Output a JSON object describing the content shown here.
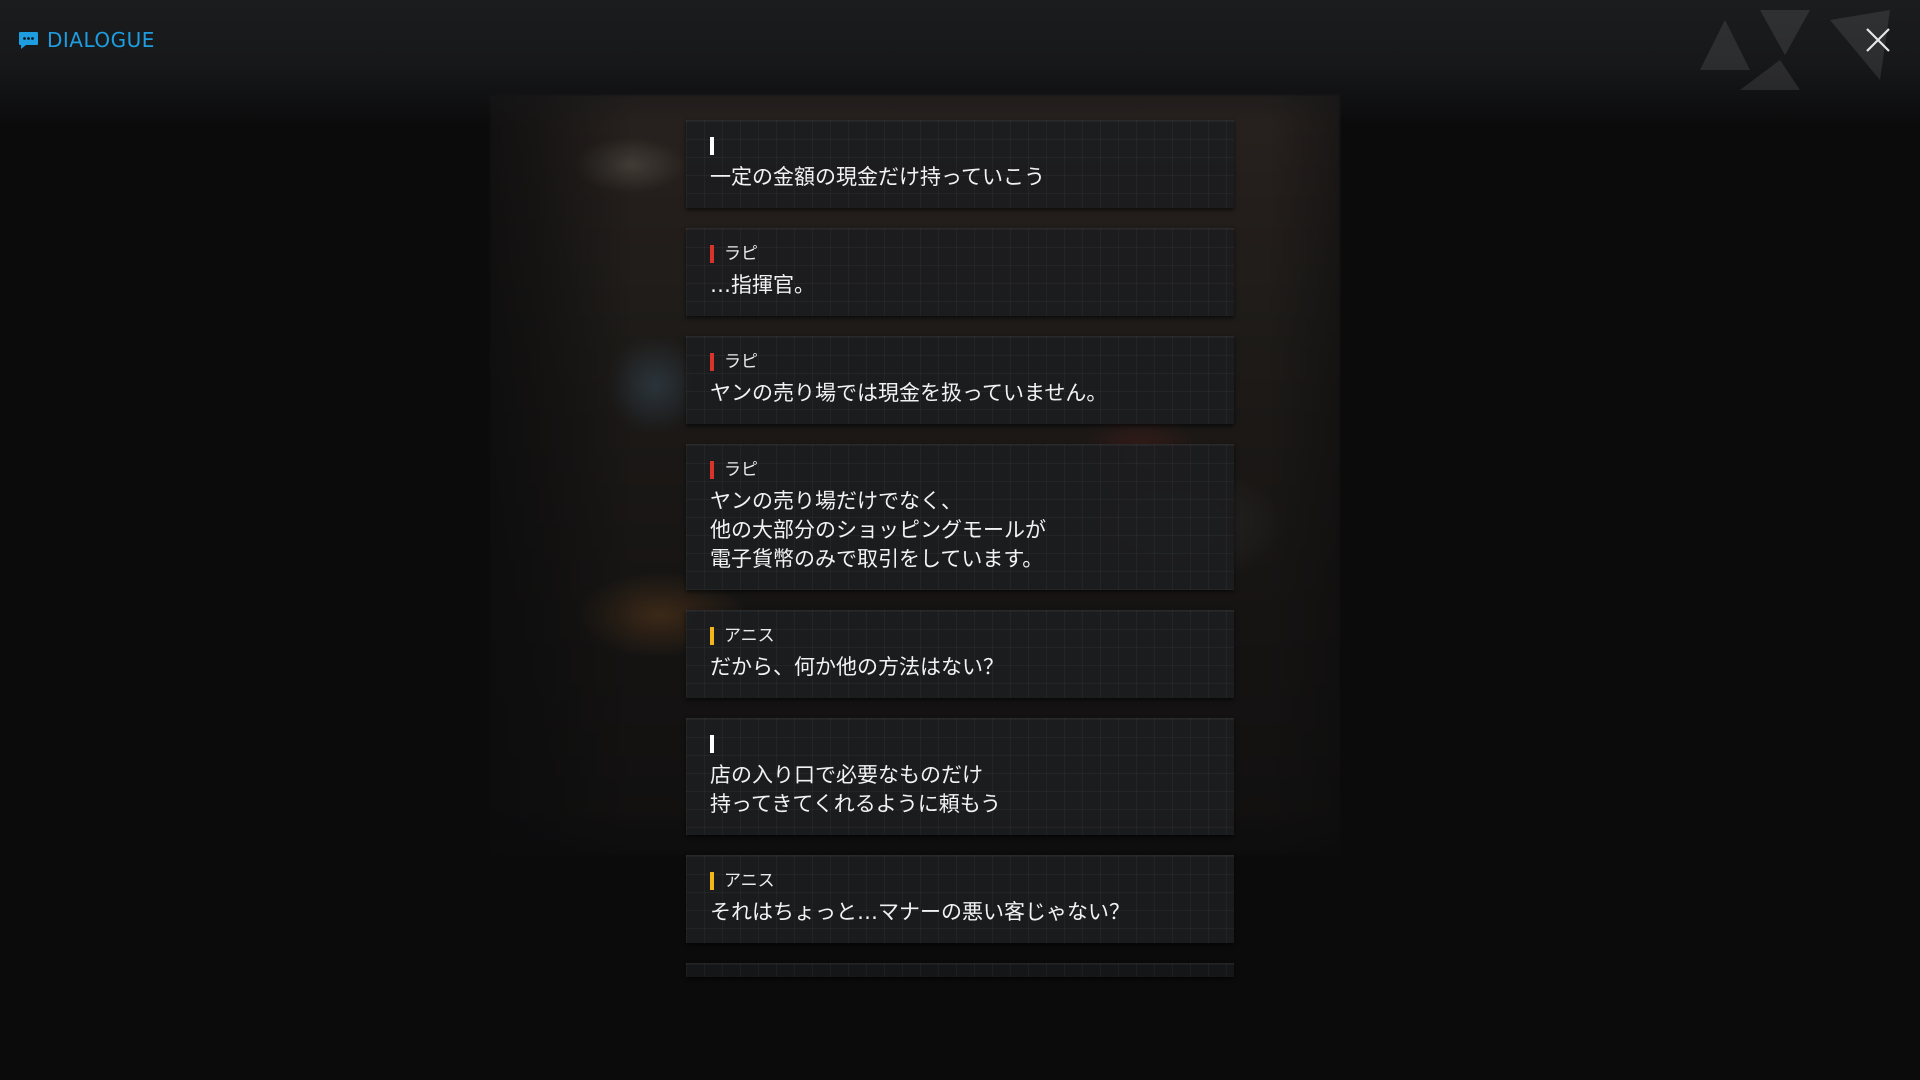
{
  "header": {
    "title": "DIALOGUE",
    "title_icon": "chat-bubble-icon",
    "close_icon": "close-icon",
    "accent_color": "#1e9de0"
  },
  "dialogue": [
    {
      "speaker": "",
      "speaker_color": "#ffffff",
      "text": "一定の金額の現金だけ持っていこう"
    },
    {
      "speaker": "ラピ",
      "speaker_color": "#d9342b",
      "text": "…指揮官。"
    },
    {
      "speaker": "ラピ",
      "speaker_color": "#d9342b",
      "text": "ヤンの売り場では現金を扱っていません。"
    },
    {
      "speaker": "ラピ",
      "speaker_color": "#d9342b",
      "text": "ヤンの売り場だけでなく、\n他の大部分のショッピングモールが\n電子貨幣のみで取引をしています。"
    },
    {
      "speaker": "アニス",
      "speaker_color": "#f2b51c",
      "text": "だから、何か他の方法はない？"
    },
    {
      "speaker": "",
      "speaker_color": "#ffffff",
      "text": "店の入り口で必要なものだけ\n持ってきてくれるように頼もう"
    },
    {
      "speaker": "アニス",
      "speaker_color": "#f2b51c",
      "text": "それはちょっと…マナーの悪い客じゃない？"
    }
  ]
}
